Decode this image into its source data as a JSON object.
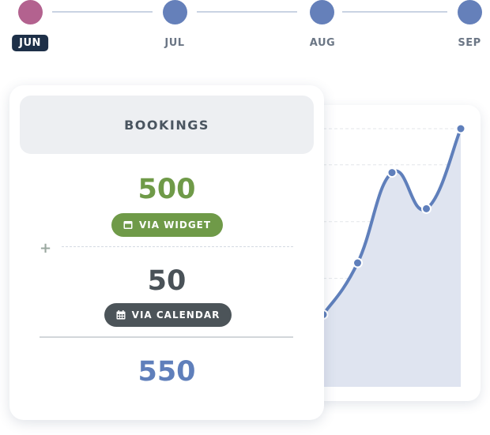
{
  "timeline": {
    "months": [
      {
        "label": "JUN",
        "active": true,
        "color": "#b3628f"
      },
      {
        "label": "JUL",
        "active": false,
        "color": "#6580ba"
      },
      {
        "label": "AUG",
        "active": false,
        "color": "#6580ba"
      },
      {
        "label": "SEP",
        "active": false,
        "color": "#6580ba"
      }
    ]
  },
  "bookings": {
    "title": "BOOKINGS",
    "widget": {
      "value": "500",
      "label": "VIA WIDGET",
      "icon": "widget-window-icon",
      "color": "#6f9a48"
    },
    "operator": "+",
    "calendar": {
      "value": "50",
      "label": "VIA CALENDAR",
      "icon": "calendar-icon",
      "color": "#4c5459"
    },
    "total": {
      "value": "550",
      "color": "#5f7fbb"
    }
  },
  "chart_data": {
    "type": "area",
    "title": "",
    "xlabel": "",
    "ylabel": "",
    "x": [
      1,
      2,
      3,
      4,
      5
    ],
    "values": [
      28,
      48,
      83,
      69,
      100
    ],
    "ylim": [
      0,
      100
    ],
    "grid": true,
    "legend": "none",
    "line_color": "#5f7fbb",
    "fill_color": "#dfe4f0",
    "note": "partially occluded by bookings card; values relative (no axis labels shown)"
  }
}
